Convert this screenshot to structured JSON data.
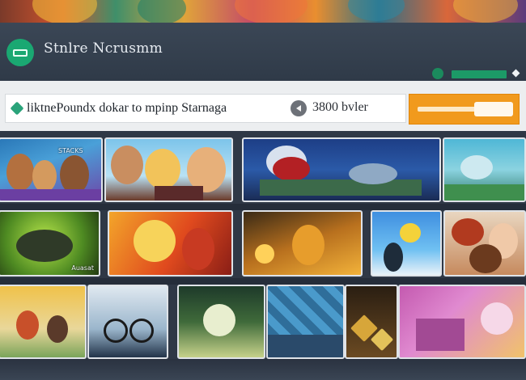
{
  "header": {
    "brand": "Stnlre Ncrusmm",
    "logo_icon": "controller-icon"
  },
  "search": {
    "text": "liktnePoundx dokar to mpinp Starnaga",
    "icon": "search-icon"
  },
  "balance": {
    "value": "3800 bvler",
    "icon": "play-back-icon"
  },
  "cta": {
    "icon": "cta-slider-icon"
  },
  "tiles": {
    "t1": {
      "overlay": "STACKS"
    },
    "t7": {
      "caption": "Auasat"
    }
  },
  "colors": {
    "accent_green": "#1aa872",
    "cta_orange": "#f19a1d",
    "topbar": "#3b4756",
    "background": "#2a3240"
  }
}
